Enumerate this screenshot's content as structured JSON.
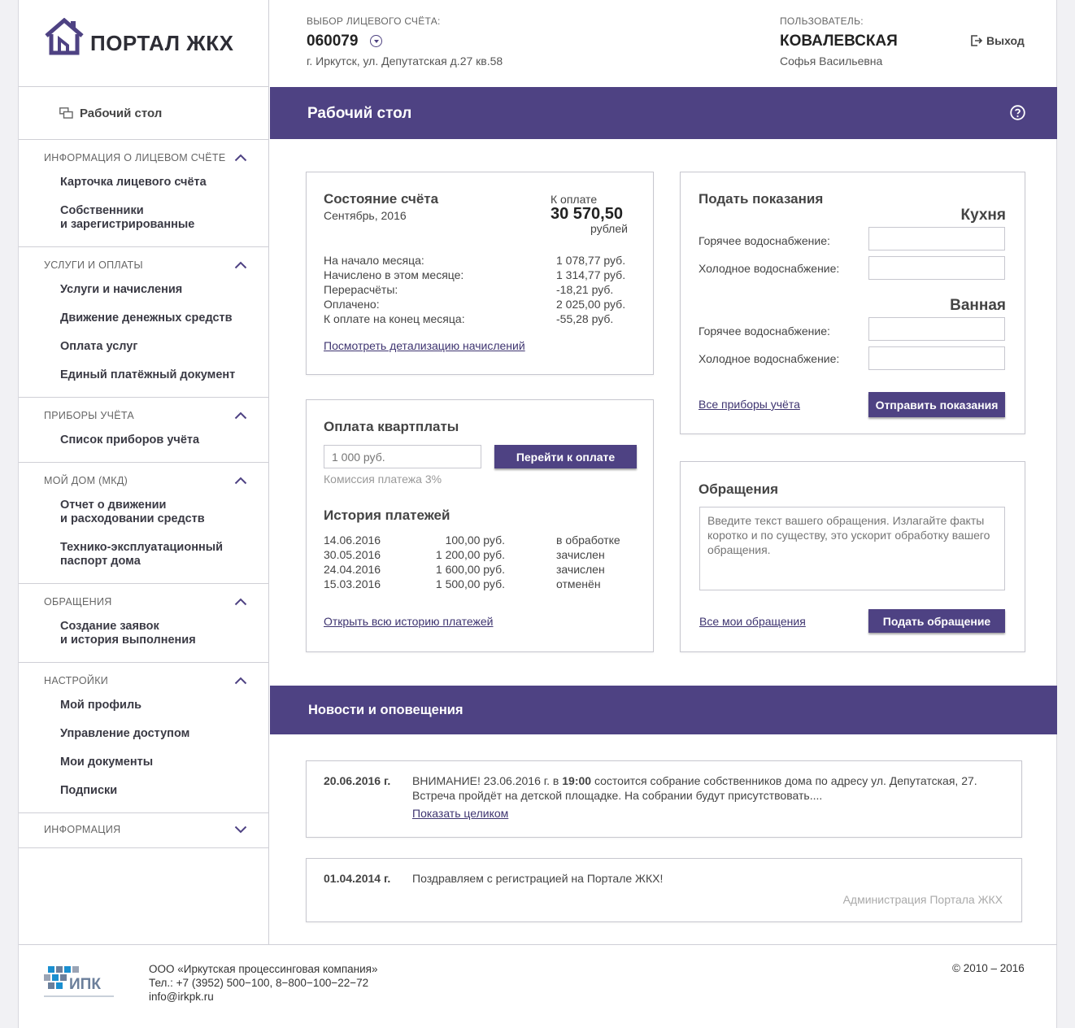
{
  "header": {
    "logo_text": "ПОРТАЛ ЖКХ",
    "account_label": "ВЫБОР ЛИЦЕВОГО СЧЁТА:",
    "account_number": "060079",
    "account_address": "г. Иркутск, ул. Депутатская д.27 кв.58",
    "user_label": "ПОЛЬЗОВАТЕЛЬ:",
    "user_surname": "КОВАЛЕВСКАЯ",
    "user_name": "Софья Васильевна",
    "logout_label": "Выход"
  },
  "sidebar": {
    "desk_label": "Рабочий стол",
    "sections": [
      {
        "title": "ИНФОРМАЦИЯ О ЛИЦЕВОМ СЧЁТЕ",
        "items": [
          "Карточка лицевого счёта",
          "Собственники\nи зарегистрированные"
        ]
      },
      {
        "title": "УСЛУГИ И ОПЛАТЫ",
        "items": [
          "Услуги и начисления",
          "Движение денежных средств",
          "Оплата услуг",
          "Единый платёжный документ"
        ]
      },
      {
        "title": "ПРИБОРЫ УЧЁТА",
        "items": [
          "Список приборов учёта"
        ]
      },
      {
        "title": "МОЙ ДОМ (МКД)",
        "items": [
          "Отчет о движении\nи расходовании средств",
          "Технико-эксплуатационный\nпаспорт дома"
        ]
      },
      {
        "title": "ОБРАЩЕНИЯ",
        "items": [
          "Создание заявок\nи история выполнения"
        ]
      },
      {
        "title": "НАСТРОЙКИ",
        "items": [
          "Мой профиль",
          "Управление доступом",
          "Мои документы",
          "Подписки"
        ]
      },
      {
        "title": "ИНФОРМАЦИЯ",
        "items": []
      }
    ]
  },
  "main": {
    "title": "Рабочий стол",
    "balance": {
      "title": "Состояние счёта",
      "period": "Сентябрь, 2016",
      "due_label": "К оплате",
      "due_amount": "30 570,50",
      "due_currency": "рублей",
      "rows": [
        {
          "label": "На начало месяца:",
          "value": "1 078,77 руб."
        },
        {
          "label": "Начислено в этом месяце:",
          "value": "1 314,77 руб."
        },
        {
          "label": "Перерасчёты:",
          "value": "-18,21 руб."
        },
        {
          "label": "Оплачено:",
          "value": "2 025,00 руб."
        },
        {
          "label": "К оплате на конец месяца:",
          "value": "-55,28 руб."
        }
      ],
      "details_link": "Посмотреть детализацию начислений"
    },
    "readings": {
      "title": "Подать показания",
      "rooms": [
        {
          "name": "Кухня",
          "hot": "Горячее водоснабжение:",
          "cold": "Холодное водоснабжение:"
        },
        {
          "name": "Ванная",
          "hot": "Горячее водоснабжение:",
          "cold": "Холодное водоснабжение:"
        }
      ],
      "all_meters_link": "Все приборы учёта",
      "submit_label": "Отправить показания"
    },
    "payment": {
      "title": "Оплата квартплаты",
      "amount_placeholder": "1 000 руб.",
      "pay_button": "Перейти к оплате",
      "commission": "Комиссия платежа 3%",
      "history_title": "История платежей",
      "history": [
        {
          "date": "14.06.2016",
          "amount": "100,00 руб.",
          "status": "в обработке"
        },
        {
          "date": "30.05.2016",
          "amount": "1 200,00 руб.",
          "status": "зачислен"
        },
        {
          "date": "24.04.2016",
          "amount": "1 600,00 руб.",
          "status": "зачислен"
        },
        {
          "date": "15.03.2016",
          "amount": "1 500,00 руб.",
          "status": "отменён"
        }
      ],
      "history_link": "Открыть всю историю платежей"
    },
    "appeals": {
      "title": "Обращения",
      "placeholder": "Введите текст вашего обращения. Излагайте факты коротко и по существу, это ускорит обработку вашего обращения.",
      "all_link": "Все мои обращения",
      "submit_label": "Подать обращение"
    }
  },
  "news": {
    "title": "Новости и оповещения",
    "items": [
      {
        "date": "20.06.2016 г.",
        "text_pre": "ВНИМАНИЕ! 23.06.2016 г. в ",
        "text_bold": "19:00",
        "text_post": " состоится собрание собственников дома по адресу ул. Депутатская, 27.",
        "text_line2": "Встреча пройдёт на детской площадке. На собрании будут присутствовать....",
        "link": "Показать целиком"
      },
      {
        "date": "01.04.2014 г.",
        "text": "Поздравляем с регистрацией на Портале ЖКХ!",
        "sign": "Администрация Портала ЖКХ"
      }
    ]
  },
  "footer": {
    "logo_text": "ИПК",
    "company": "ООО «Иркутская процессинговая компания»",
    "phone": "Тел.: +7 (3952) 500−100, 8−800−100−22−72",
    "email": "info@irkpk.ru",
    "copyright": "© 2010 – 2016"
  },
  "colors": {
    "accent": "#4e4283",
    "link": "#3e3470",
    "border": "#c7c7cf"
  }
}
